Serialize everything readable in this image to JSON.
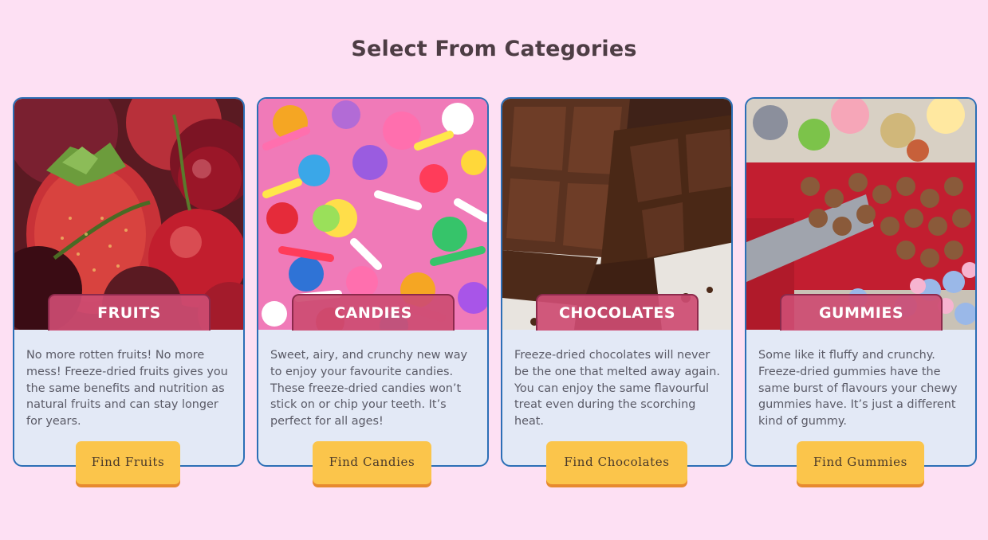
{
  "page": {
    "title": "Select From Categories"
  },
  "cards": [
    {
      "label": "FRUITS",
      "image": "strawberries-and-cherries-photo",
      "description": "No more rotten fruits! No more mess! Freeze-dried fruits gives you the same benefits and nutrition as natural fruits and can stay longer for years.",
      "button": "Find Fruits"
    },
    {
      "label": "CANDIES",
      "image": "colorful-sprinkles-photo",
      "description": "Sweet, airy, and crunchy new way to enjoy your favourite candies. These freeze-dried candies won’t stick on or chip your teeth. It’s perfect for all ages!",
      "button": "Find Candies"
    },
    {
      "label": "CHOCOLATES",
      "image": "chocolate-bar-pieces-photo",
      "description": "Freeze-dried chocolates will never be the one that melted away again. You can enjoy the same flavourful treat even during the scorching heat.",
      "button": "Find Chocolates"
    },
    {
      "label": "GUMMIES",
      "image": "freeze-dried-gummies-photo",
      "description": "Some like it fluffy and crunchy. Freeze-dried gummies have the same burst of flavours your chewy gummies have. It’s just a different kind of gummy.",
      "button": "Find Gummies"
    }
  ],
  "colors": {
    "background": "#fde0f3",
    "card_background": "#e3e9f6",
    "card_border": "#2c6fb6",
    "label_background": "#cd4c72",
    "button_background": "#fbc54b",
    "button_shadow": "#e78a2e"
  }
}
